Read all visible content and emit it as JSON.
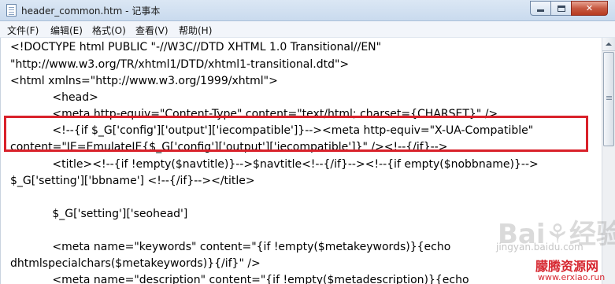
{
  "window": {
    "title": "header_common.htm - 记事本",
    "controls": {
      "minimize": "",
      "maximize": "",
      "close": "✕"
    }
  },
  "menu": {
    "items": [
      "文件(F)",
      "编辑(E)",
      "格式(O)",
      "查看(V)",
      "帮助(H)"
    ]
  },
  "editor": {
    "lines": [
      "<!DOCTYPE html PUBLIC \"-//W3C//DTD XHTML 1.0 Transitional//EN\"",
      "\"http://www.w3.org/TR/xhtml1/DTD/xhtml1-transitional.dtd\">",
      "<html xmlns=\"http://www.w3.org/1999/xhtml\">",
      "            <head>",
      "            <meta http-equiv=\"Content-Type\" content=\"text/html; charset={CHARSET}\" />",
      "            <!--{if $_G['config']['output']['iecompatible']}--><meta http-equiv=\"X-UA-Compatible\"",
      "content=\"IE=EmulateIE{$_G['config']['output']['iecompatible']}\" /><!--{/if}-->",
      "            <title><!--{if !empty($navtitle)}-->$navtitle<!--{/if}--><!--{if empty($nobbname)}-->",
      "$_G['setting']['bbname'] <!--{/if}--></title>",
      "",
      "            $_G['setting']['seohead']",
      "",
      "            <meta name=\"keywords\" content=\"{if !empty($metakeywords)}{echo",
      "dhtmlspecialchars($metakeywords)}{/if}\" />",
      "            <meta name=\"description\" content=\"{if !empty($metadescription)}{echo"
    ]
  },
  "watermark": {
    "logo": "Bai⚘经验",
    "sub": "jingyan.baidu.com",
    "site_name": "朦腾资源网",
    "site_url": "www.erxiao.run"
  }
}
